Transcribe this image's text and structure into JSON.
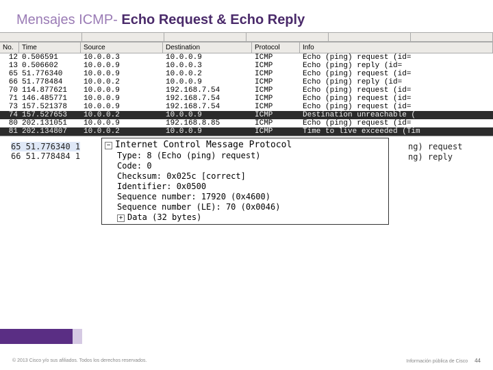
{
  "title": {
    "prefix": "Mensajes ICMP- ",
    "main": "Echo Request & Echo Reply"
  },
  "columns": {
    "no": "No.",
    "time": "Time",
    "source": "Source",
    "destination": "Destination",
    "protocol": "Protocol",
    "info": "Info"
  },
  "rows": [
    {
      "no": "12",
      "time": "0.506591",
      "src": "10.0.0.3",
      "dst": "10.0.0.9",
      "proto": "ICMP",
      "info": "Echo (ping) request  (id="
    },
    {
      "no": "13",
      "time": "0.506602",
      "src": "10.0.0.9",
      "dst": "10.0.0.3",
      "proto": "ICMP",
      "info": "Echo (ping) reply    (id="
    },
    {
      "no": "65",
      "time": "51.776340",
      "src": "10.0.0.9",
      "dst": "10.0.0.2",
      "proto": "ICMP",
      "info": "Echo (ping) request  (id="
    },
    {
      "no": "66",
      "time": "51.778484",
      "src": "10.0.0.2",
      "dst": "10.0.0.9",
      "proto": "ICMP",
      "info": "Echo (ping) reply    (id="
    },
    {
      "no": "70",
      "time": "114.877621",
      "src": "10.0.0.9",
      "dst": "192.168.7.54",
      "proto": "ICMP",
      "info": "Echo (ping) request  (id="
    },
    {
      "no": "71",
      "time": "146.485771",
      "src": "10.0.0.9",
      "dst": "192.168.7.54",
      "proto": "ICMP",
      "info": "Echo (ping) request  (id="
    },
    {
      "no": "73",
      "time": "157.521378",
      "src": "10.0.0.9",
      "dst": "192.168.7.54",
      "proto": "ICMP",
      "info": "Echo (ping) request  (id="
    },
    {
      "no": "74",
      "time": "157.527653",
      "src": "10.0.0.2",
      "dst": "10.0.0.9",
      "proto": "ICMP",
      "info": "Destination unreachable (",
      "hl": true
    },
    {
      "no": "80",
      "time": "202.131051",
      "src": "10.0.0.9",
      "dst": "192.168.8.85",
      "proto": "ICMP",
      "info": "Echo (ping) request  (id="
    },
    {
      "no": "81",
      "time": "202.134807",
      "src": "10.0.0.2",
      "dst": "10.0.0.9",
      "proto": "ICMP",
      "info": "Time to live exceeded (Tim",
      "hl": true
    }
  ],
  "back_rows": {
    "r1": "65 51.776340   1",
    "r2": "66 51.778484   1",
    "side1": "ng) request",
    "side2": "ng) reply"
  },
  "detail": {
    "header": "Internet Control Message Protocol",
    "type": "Type: 8 (Echo (ping) request)",
    "code": "Code: 0",
    "checksum": "Checksum: 0x025c [correct]",
    "identifier": "Identifier: 0x0500",
    "seq": "Sequence number: 17920 (0x4600)",
    "seq_le": "Sequence number (LE): 70 (0x0046)",
    "data": "Data (32 bytes)",
    "minus": "−",
    "plus": "+"
  },
  "footer": {
    "left": "© 2013 Cisco y/o sus afiliados. Todos los derechos reservados.",
    "right": "Información pública de Cisco",
    "page": "44"
  }
}
